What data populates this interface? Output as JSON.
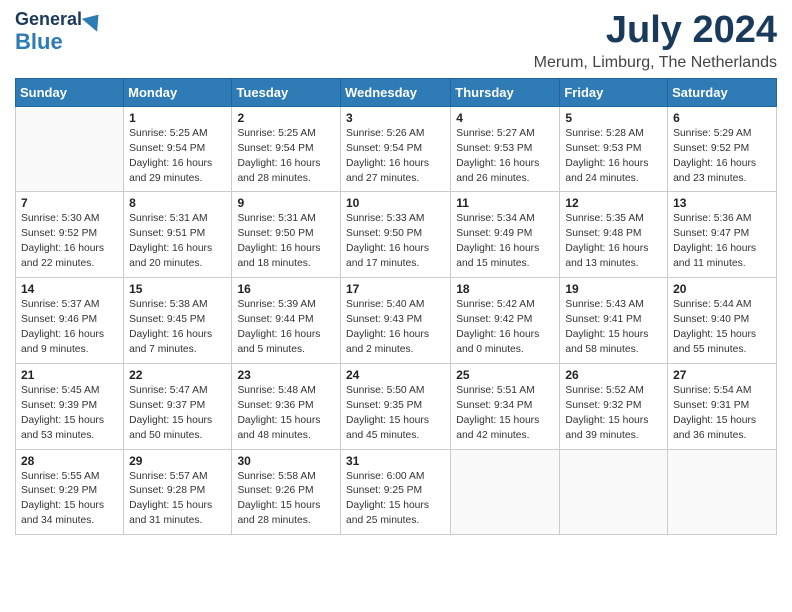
{
  "header": {
    "logo_line1": "General",
    "logo_line2": "Blue",
    "month_year": "July 2024",
    "location": "Merum, Limburg, The Netherlands"
  },
  "weekdays": [
    "Sunday",
    "Monday",
    "Tuesday",
    "Wednesday",
    "Thursday",
    "Friday",
    "Saturday"
  ],
  "weeks": [
    [
      {
        "day": "",
        "info": ""
      },
      {
        "day": "1",
        "info": "Sunrise: 5:25 AM\nSunset: 9:54 PM\nDaylight: 16 hours\nand 29 minutes."
      },
      {
        "day": "2",
        "info": "Sunrise: 5:25 AM\nSunset: 9:54 PM\nDaylight: 16 hours\nand 28 minutes."
      },
      {
        "day": "3",
        "info": "Sunrise: 5:26 AM\nSunset: 9:54 PM\nDaylight: 16 hours\nand 27 minutes."
      },
      {
        "day": "4",
        "info": "Sunrise: 5:27 AM\nSunset: 9:53 PM\nDaylight: 16 hours\nand 26 minutes."
      },
      {
        "day": "5",
        "info": "Sunrise: 5:28 AM\nSunset: 9:53 PM\nDaylight: 16 hours\nand 24 minutes."
      },
      {
        "day": "6",
        "info": "Sunrise: 5:29 AM\nSunset: 9:52 PM\nDaylight: 16 hours\nand 23 minutes."
      }
    ],
    [
      {
        "day": "7",
        "info": "Sunrise: 5:30 AM\nSunset: 9:52 PM\nDaylight: 16 hours\nand 22 minutes."
      },
      {
        "day": "8",
        "info": "Sunrise: 5:31 AM\nSunset: 9:51 PM\nDaylight: 16 hours\nand 20 minutes."
      },
      {
        "day": "9",
        "info": "Sunrise: 5:31 AM\nSunset: 9:50 PM\nDaylight: 16 hours\nand 18 minutes."
      },
      {
        "day": "10",
        "info": "Sunrise: 5:33 AM\nSunset: 9:50 PM\nDaylight: 16 hours\nand 17 minutes."
      },
      {
        "day": "11",
        "info": "Sunrise: 5:34 AM\nSunset: 9:49 PM\nDaylight: 16 hours\nand 15 minutes."
      },
      {
        "day": "12",
        "info": "Sunrise: 5:35 AM\nSunset: 9:48 PM\nDaylight: 16 hours\nand 13 minutes."
      },
      {
        "day": "13",
        "info": "Sunrise: 5:36 AM\nSunset: 9:47 PM\nDaylight: 16 hours\nand 11 minutes."
      }
    ],
    [
      {
        "day": "14",
        "info": "Sunrise: 5:37 AM\nSunset: 9:46 PM\nDaylight: 16 hours\nand 9 minutes."
      },
      {
        "day": "15",
        "info": "Sunrise: 5:38 AM\nSunset: 9:45 PM\nDaylight: 16 hours\nand 7 minutes."
      },
      {
        "day": "16",
        "info": "Sunrise: 5:39 AM\nSunset: 9:44 PM\nDaylight: 16 hours\nand 5 minutes."
      },
      {
        "day": "17",
        "info": "Sunrise: 5:40 AM\nSunset: 9:43 PM\nDaylight: 16 hours\nand 2 minutes."
      },
      {
        "day": "18",
        "info": "Sunrise: 5:42 AM\nSunset: 9:42 PM\nDaylight: 16 hours\nand 0 minutes."
      },
      {
        "day": "19",
        "info": "Sunrise: 5:43 AM\nSunset: 9:41 PM\nDaylight: 15 hours\nand 58 minutes."
      },
      {
        "day": "20",
        "info": "Sunrise: 5:44 AM\nSunset: 9:40 PM\nDaylight: 15 hours\nand 55 minutes."
      }
    ],
    [
      {
        "day": "21",
        "info": "Sunrise: 5:45 AM\nSunset: 9:39 PM\nDaylight: 15 hours\nand 53 minutes."
      },
      {
        "day": "22",
        "info": "Sunrise: 5:47 AM\nSunset: 9:37 PM\nDaylight: 15 hours\nand 50 minutes."
      },
      {
        "day": "23",
        "info": "Sunrise: 5:48 AM\nSunset: 9:36 PM\nDaylight: 15 hours\nand 48 minutes."
      },
      {
        "day": "24",
        "info": "Sunrise: 5:50 AM\nSunset: 9:35 PM\nDaylight: 15 hours\nand 45 minutes."
      },
      {
        "day": "25",
        "info": "Sunrise: 5:51 AM\nSunset: 9:34 PM\nDaylight: 15 hours\nand 42 minutes."
      },
      {
        "day": "26",
        "info": "Sunrise: 5:52 AM\nSunset: 9:32 PM\nDaylight: 15 hours\nand 39 minutes."
      },
      {
        "day": "27",
        "info": "Sunrise: 5:54 AM\nSunset: 9:31 PM\nDaylight: 15 hours\nand 36 minutes."
      }
    ],
    [
      {
        "day": "28",
        "info": "Sunrise: 5:55 AM\nSunset: 9:29 PM\nDaylight: 15 hours\nand 34 minutes."
      },
      {
        "day": "29",
        "info": "Sunrise: 5:57 AM\nSunset: 9:28 PM\nDaylight: 15 hours\nand 31 minutes."
      },
      {
        "day": "30",
        "info": "Sunrise: 5:58 AM\nSunset: 9:26 PM\nDaylight: 15 hours\nand 28 minutes."
      },
      {
        "day": "31",
        "info": "Sunrise: 6:00 AM\nSunset: 9:25 PM\nDaylight: 15 hours\nand 25 minutes."
      },
      {
        "day": "",
        "info": ""
      },
      {
        "day": "",
        "info": ""
      },
      {
        "day": "",
        "info": ""
      }
    ]
  ]
}
